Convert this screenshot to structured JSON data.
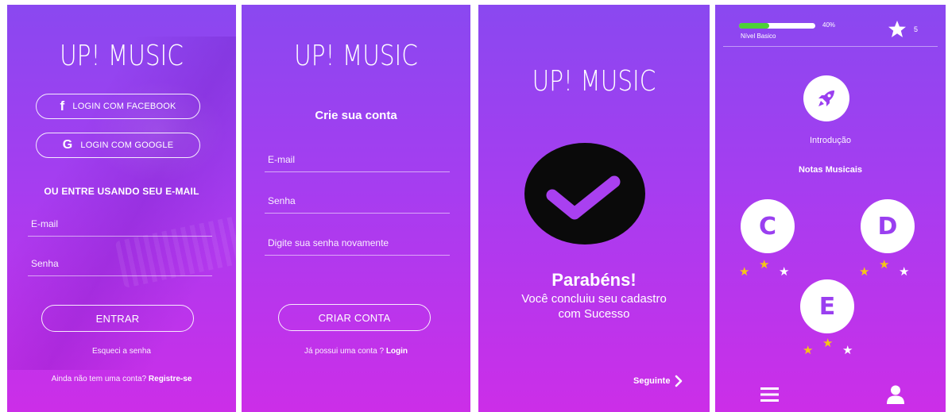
{
  "colors": {
    "gradient_top": "#8a48f0",
    "gradient_bottom": "#cc2ee8",
    "progress": "#4cd137",
    "star_on": "#f5c518",
    "star_off": "#ffffff",
    "check_bg": "#0a0a0a"
  },
  "login": {
    "logo": "UP! MUSIC",
    "facebook_label": "LOGIN COM FACEBOOK",
    "google_label": "LOGIN COM GOOGLE",
    "email_heading": "OU ENTRE USANDO SEU E-MAIL",
    "email_placeholder": "E-mail",
    "password_placeholder": "Senha",
    "submit_label": "ENTRAR",
    "forgot_label": "Esqueci a senha",
    "no_account_text": "Ainda não tem uma conta?",
    "register_label": "Registre-se",
    "icons": {
      "facebook": "facebook-icon",
      "google": "google-icon"
    }
  },
  "signup": {
    "logo": "UP! MUSIC",
    "title": "Crie sua conta",
    "email_placeholder": "E-mail",
    "password_placeholder": "Senha",
    "confirm_placeholder": "Digite sua senha novamente",
    "submit_label": "CRIAR CONTA",
    "have_account_text": "Já possui uma conta ?",
    "login_link": "Login"
  },
  "success": {
    "logo": "UP! MUSIC",
    "title": "Parabéns!",
    "message_line1": "Você concluiu seu cadastro",
    "message_line2": "com Sucesso",
    "next_label": "Seguinte",
    "icons": {
      "check": "check-icon",
      "next": "chevron-right-icon"
    }
  },
  "lessons": {
    "progress_percent": 40,
    "progress_label": "40%",
    "level_label": "Nível Basico",
    "stars_count": "5",
    "intro_label": "Introdução",
    "section_title": "Notas Musicais",
    "notes": [
      {
        "letter": "C",
        "stars": [
          true,
          true,
          false
        ]
      },
      {
        "letter": "D",
        "stars": [
          true,
          true,
          false
        ]
      },
      {
        "letter": "E",
        "stars": [
          true,
          true,
          false
        ]
      }
    ],
    "icons": {
      "star": "star-icon",
      "rocket": "rocket-icon",
      "menu": "menu-icon",
      "profile": "user-icon"
    }
  }
}
